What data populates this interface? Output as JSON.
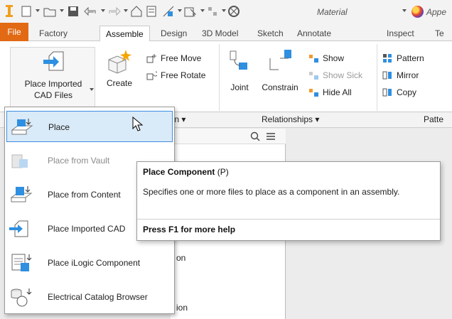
{
  "quick_access": {
    "material_value": "Material",
    "appearance_value": "Appe"
  },
  "tabs": [
    {
      "label": "File"
    },
    {
      "label": "Factory"
    },
    {
      "label": "Assemble"
    },
    {
      "label": "Design"
    },
    {
      "label": "3D Model"
    },
    {
      "label": "Sketch"
    },
    {
      "label": "Annotate"
    },
    {
      "label": "Inspect"
    },
    {
      "label": "Te"
    }
  ],
  "ribbon": {
    "place_imported_line1": "Place Imported",
    "place_imported_line2": "CAD Files",
    "create_label": "Create",
    "free_move_label": "Free Move",
    "free_rotate_label": "Free Rotate",
    "joint_label": "Joint",
    "constrain_label": "Constrain",
    "show_label": "Show",
    "show_sick_label": "Show Sick",
    "hide_all_label": "Hide All",
    "pattern_label": "Pattern",
    "mirror_label": "Mirror",
    "copy_label": "Copy",
    "panel_position_fragment": "ion ▾",
    "panel_relationships": "Relationships ▾",
    "panel_pattern_fragment": "Patte"
  },
  "menu": {
    "items": [
      {
        "label": "Place",
        "state": "selected"
      },
      {
        "label": "Place from Vault",
        "state": "disabled"
      },
      {
        "label": "Place from Content",
        "state": "normal"
      },
      {
        "label": "Place Imported CAD",
        "state": "normal"
      },
      {
        "label": "Place iLogic Component",
        "state": "normal"
      },
      {
        "label": "Electrical  Catalog Browser",
        "state": "normal"
      }
    ]
  },
  "tooltip": {
    "title": "Place Component",
    "shortcut": "(P)",
    "description": "Specifies one or more files to place as a component in an assembly.",
    "help": "Press F1 for more help"
  },
  "browser": {
    "fragment_1": "on",
    "fragment_2": "ion"
  },
  "colors": {
    "file_tab": "#e26a14",
    "selection_fill": "#d9eaf8",
    "selection_border": "#3d8ee0",
    "icon_blue": "#2f8fe0",
    "logo_orange": "#f0a020"
  }
}
